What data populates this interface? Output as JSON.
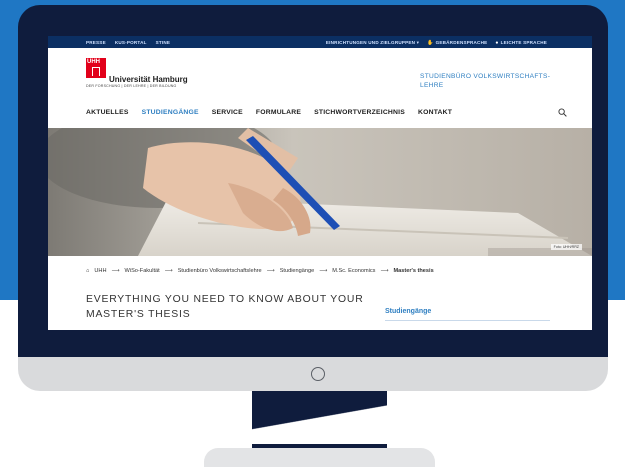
{
  "topbar": {
    "left_links": [
      "PRESSE",
      "KUS-PORTAL",
      "STINE"
    ],
    "right_links": [
      {
        "label": "EINRICHTUNGEN UND ZIELGRUPPEN ▾",
        "icon": ""
      },
      {
        "label": "GEBÄRDENSPRACHE",
        "icon": "sign-language-icon"
      },
      {
        "label": "LEICHTE SPRACHE",
        "icon": "easy-language-icon"
      }
    ]
  },
  "logo": {
    "mark": "UHH",
    "name": "Universität Hamburg",
    "tagline": "DER FORSCHUNG | DER LEHRE | DER BILDUNG"
  },
  "office_name": "STUDIENBÜRO VOLKSWIRTSCHAFTS-LEHRE",
  "nav": {
    "items": [
      {
        "label": "AKTUELLES",
        "active": false
      },
      {
        "label": "STUDIENGÄNGE",
        "active": true
      },
      {
        "label": "SERVICE",
        "active": false
      },
      {
        "label": "FORMULARE",
        "active": false
      },
      {
        "label": "STICHWORTVERZEICHNIS",
        "active": false
      },
      {
        "label": "KONTAKT",
        "active": false
      }
    ]
  },
  "hero": {
    "credit": "Foto: UHH/RRZ"
  },
  "breadcrumb": {
    "home": "UHH",
    "items": [
      "WiSo-Fakultät",
      "Studienbüro Volkswirtschaftslehre",
      "Studiengänge",
      "M.Sc. Economics"
    ],
    "current": "Master's thesis"
  },
  "main_title": "EVERYTHING YOU NEED TO KNOW ABOUT YOUR MASTER'S THESIS",
  "sidebar": {
    "title": "Studiengänge"
  },
  "colors": {
    "brand_red": "#e2001a",
    "accent_blue": "#2f7fc1",
    "topbar": "#0b2f63",
    "background_blue": "#1f77c4",
    "monitor_frame": "#0f1c3d"
  }
}
